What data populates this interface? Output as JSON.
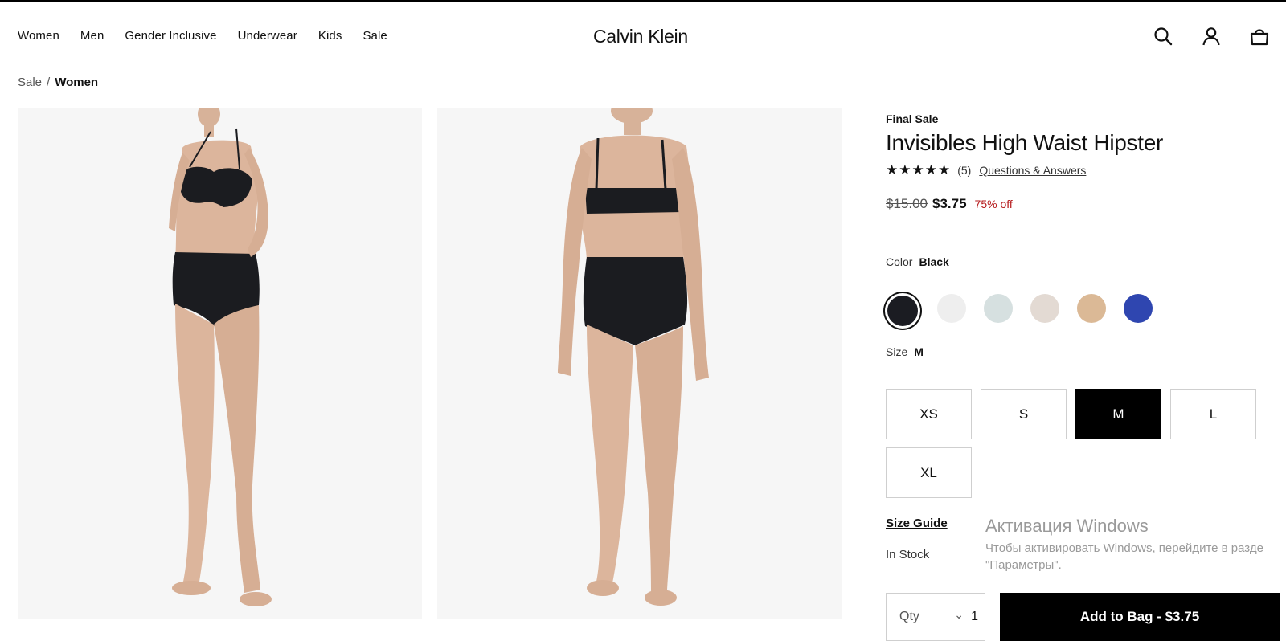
{
  "nav": {
    "items": [
      "Women",
      "Men",
      "Gender Inclusive",
      "Underwear",
      "Kids",
      "Sale"
    ]
  },
  "brand": "Calvin Klein",
  "header_icons": [
    "search-icon",
    "account-icon",
    "bag-icon"
  ],
  "breadcrumb": {
    "items": [
      "Sale",
      "Women"
    ],
    "separator": "/"
  },
  "images": [
    {
      "alt": "front-view",
      "name": "product-image-front"
    },
    {
      "alt": "back-view",
      "name": "product-image-back"
    }
  ],
  "product": {
    "badge": "Final Sale",
    "title": "Invisibles High Waist Hipster",
    "stars": "★★★★★",
    "rating": 5,
    "reviews": "(5)",
    "qa_link": "Questions & Answers",
    "old_price": "$15.00",
    "price": "$3.75",
    "discount": "75% off",
    "color_label": "Color",
    "color_value": "Black",
    "colors": [
      "#1b1c22",
      "#eeeeee",
      "#d6e0e0",
      "#e3dad3",
      "#dbb996",
      "#2f46b0"
    ],
    "selected_color_index": 0,
    "size_label": "Size",
    "size_value": "M",
    "sizes": [
      "XS",
      "S",
      "M",
      "L",
      "XL"
    ],
    "selected_size": "M",
    "size_guide": "Size Guide",
    "stock": "In Stock",
    "qty_label": "Qty",
    "qty_value": "1",
    "add_to_bag": "Add to Bag - $3.75"
  },
  "watermark": {
    "title": "Активация Windows",
    "line1": "Чтобы активировать Windows, перейдите в разде",
    "line2": "\"Параметры\"."
  }
}
